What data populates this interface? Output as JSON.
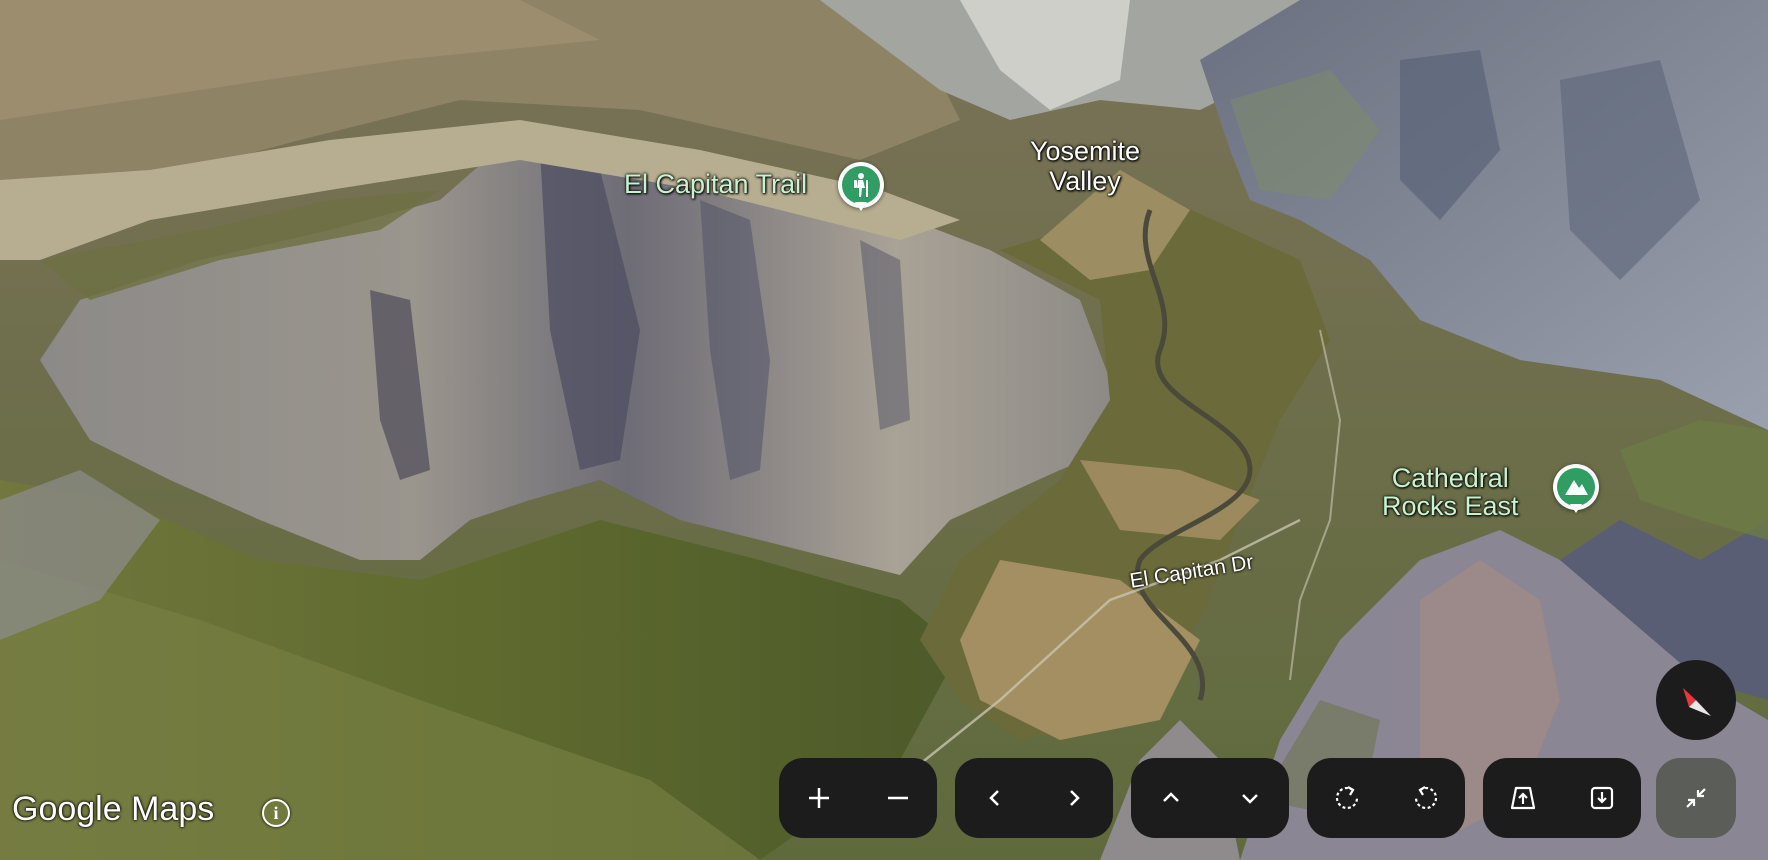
{
  "map": {
    "labels": {
      "valley_line1": "Yosemite",
      "valley_line2": "Valley",
      "road": "El Capitan Dr"
    },
    "pois": [
      {
        "name": "El Capitan Trail",
        "icon": "hiking-icon"
      },
      {
        "name_line1": "Cathedral",
        "name_line2": "Rocks East",
        "icon": "mountain-icon"
      }
    ]
  },
  "branding": {
    "text": "Google Maps",
    "info_icon": "info-icon"
  },
  "controls": {
    "zoom": [
      "zoom-in-icon",
      "zoom-out-icon"
    ],
    "pan": [
      "chevron-left-icon",
      "chevron-right-icon"
    ],
    "tilt": [
      "chevron-up-icon",
      "chevron-down-icon"
    ],
    "rotate": [
      "rotate-left-icon",
      "rotate-right-icon"
    ],
    "view": [
      "tilt-up-icon",
      "tilt-down-icon"
    ],
    "compass": "compass-icon",
    "collapse": "collapse-icon"
  },
  "colors": {
    "poi_green": "#2e9e63",
    "poi_label": "#c9f2cf",
    "control_bg": "#1c1c1c",
    "compass_red": "#e53935"
  }
}
